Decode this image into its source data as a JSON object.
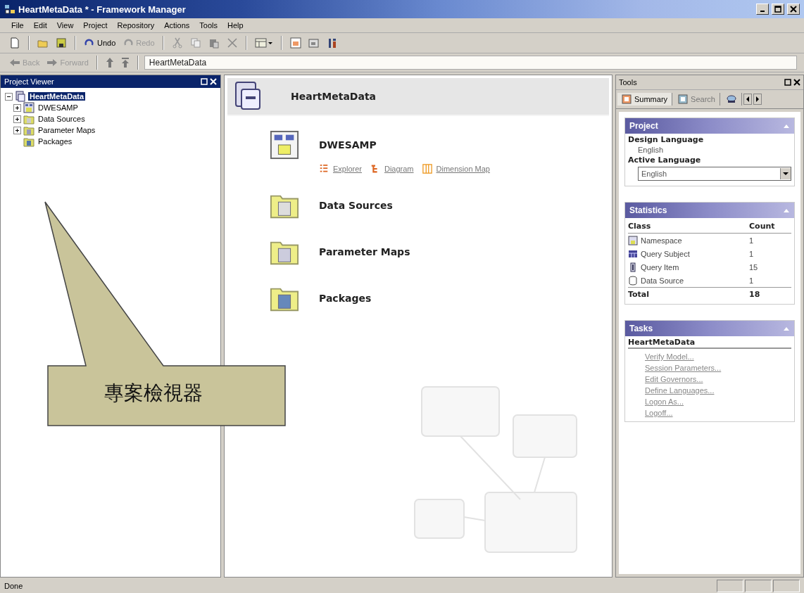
{
  "window": {
    "title": "HeartMetaData * - Framework Manager"
  },
  "menu": [
    "File",
    "Edit",
    "View",
    "Project",
    "Repository",
    "Actions",
    "Tools",
    "Help"
  ],
  "toolbar": {
    "undo": {
      "label": "Undo",
      "disabled": false
    },
    "redo": {
      "label": "Redo",
      "disabled": true
    }
  },
  "navbar": {
    "back": {
      "label": "Back",
      "disabled": true
    },
    "forward": {
      "label": "Forward",
      "disabled": true
    },
    "path": "HeartMetaData"
  },
  "project_viewer": {
    "title": "Project Viewer",
    "tree": [
      {
        "label": "HeartMetaData",
        "selected": true,
        "expanded": true,
        "children": [
          {
            "label": "DWESAMP",
            "selected": false,
            "expanded": false
          },
          {
            "label": "Data Sources",
            "selected": false,
            "expanded": false
          },
          {
            "label": "Parameter Maps",
            "selected": false,
            "expanded": false
          },
          {
            "label": "Packages",
            "selected": false
          }
        ]
      }
    ]
  },
  "main": {
    "title": "HeartMetaData",
    "items": [
      {
        "label": "DWESAMP",
        "links": [
          "Explorer",
          "Diagram",
          "Dimension Map"
        ]
      },
      {
        "label": "Data Sources"
      },
      {
        "label": "Parameter Maps"
      },
      {
        "label": "Packages"
      }
    ]
  },
  "tools": {
    "title": "Tools",
    "tabs": [
      {
        "label": "Summary",
        "selected": true
      },
      {
        "label": "Search",
        "selected": false
      }
    ],
    "project": {
      "title": "Project",
      "design_language_label": "Design Language",
      "design_language": "English",
      "active_language_label": "Active Language",
      "active_language": "English"
    },
    "statistics": {
      "title": "Statistics",
      "columns": [
        "Class",
        "Count"
      ],
      "rows": [
        {
          "class": "Namespace",
          "count": "1"
        },
        {
          "class": "Query Subject",
          "count": "1"
        },
        {
          "class": "Query Item",
          "count": "15"
        },
        {
          "class": "Data Source",
          "count": "1"
        }
      ],
      "total_label": "Total",
      "total": "18"
    },
    "tasks": {
      "title": "Tasks",
      "heading": "HeartMetaData",
      "links": [
        "Verify Model...",
        "Session Parameters...",
        "Edit Governors...",
        "Define Languages...",
        "Logon As...",
        "Logoff..."
      ]
    }
  },
  "callout": {
    "text": "專案檢視器"
  },
  "status_bar": {
    "text": "Done"
  }
}
